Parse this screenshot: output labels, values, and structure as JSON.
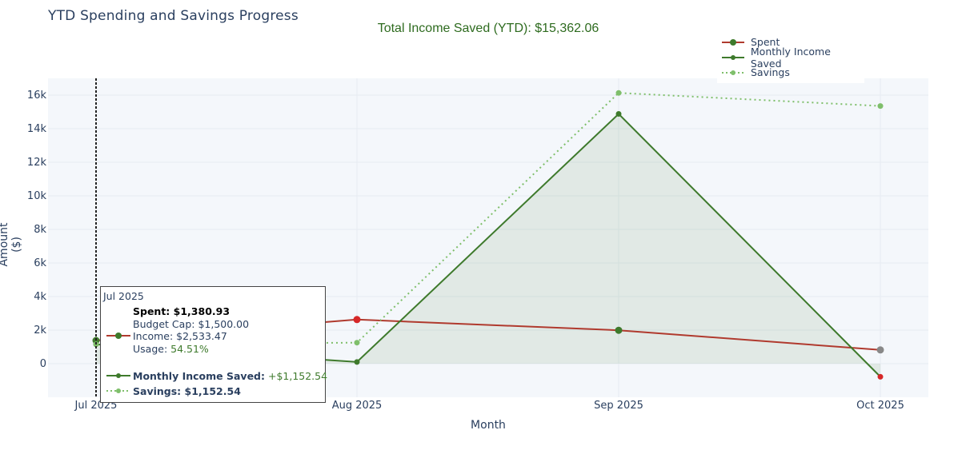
{
  "title": "YTD Spending and Savings Progress",
  "subtitle": "Total Income Saved (YTD): $15,362.06",
  "colors": {
    "spent": "#b03a2e",
    "spent_marker_red": "#d62728",
    "income_saved": "#3e7a2c",
    "savings": "#7fbf6b",
    "fill": "rgba(62,122,44,0.10)",
    "plot_bg": "#f4f7fb",
    "grid": "#e6ebf2",
    "text": "#2a3f5f",
    "subtitle": "#2e6b1f",
    "highlight_gray": "#888888"
  },
  "legend": {
    "items": [
      {
        "label": "Spent",
        "key": "spent",
        "dash": false
      },
      {
        "label": "Monthly Income Saved",
        "key": "income_saved",
        "dash": false
      },
      {
        "label": "Savings",
        "key": "savings",
        "dash": true
      }
    ]
  },
  "chart_data": {
    "type": "line",
    "title": "YTD Spending and Savings Progress",
    "xlabel": "Month",
    "ylabel": "Amount ($)",
    "categories": [
      "Jul 2025",
      "Aug 2025",
      "Sep 2025",
      "Oct 2025"
    ],
    "ylim": [
      -2000,
      17000
    ],
    "yticks": [
      0,
      2000,
      4000,
      6000,
      8000,
      10000,
      12000,
      14000,
      16000
    ],
    "ytick_labels": [
      "0",
      "2k",
      "4k",
      "6k",
      "8k",
      "10k",
      "12k",
      "14k",
      "16k"
    ],
    "series": [
      {
        "name": "Spent",
        "values": [
          1380.93,
          2630,
          1990,
          820
        ]
      },
      {
        "name": "Monthly Income Saved",
        "values": [
          1152.54,
          100,
          14880,
          -780
        ]
      },
      {
        "name": "Savings",
        "values": [
          1152.54,
          1252.54,
          16132.54,
          15352.54
        ]
      }
    ],
    "grid": true,
    "legend_position": "top-right",
    "hover_marker": "Jul 2025"
  },
  "tooltip": {
    "header": "Jul 2025",
    "spent_line": "Spent: $1,380.93",
    "budget_line": "Budget Cap: $1,500.00",
    "income_line": "Income: $2,533.47",
    "usage_prefix": "Usage: ",
    "usage_value": "54.51%",
    "monthly_label": "Monthly Income Saved:",
    "monthly_value": " +$1,152.54",
    "savings_line": "Savings: $1,152.54"
  }
}
